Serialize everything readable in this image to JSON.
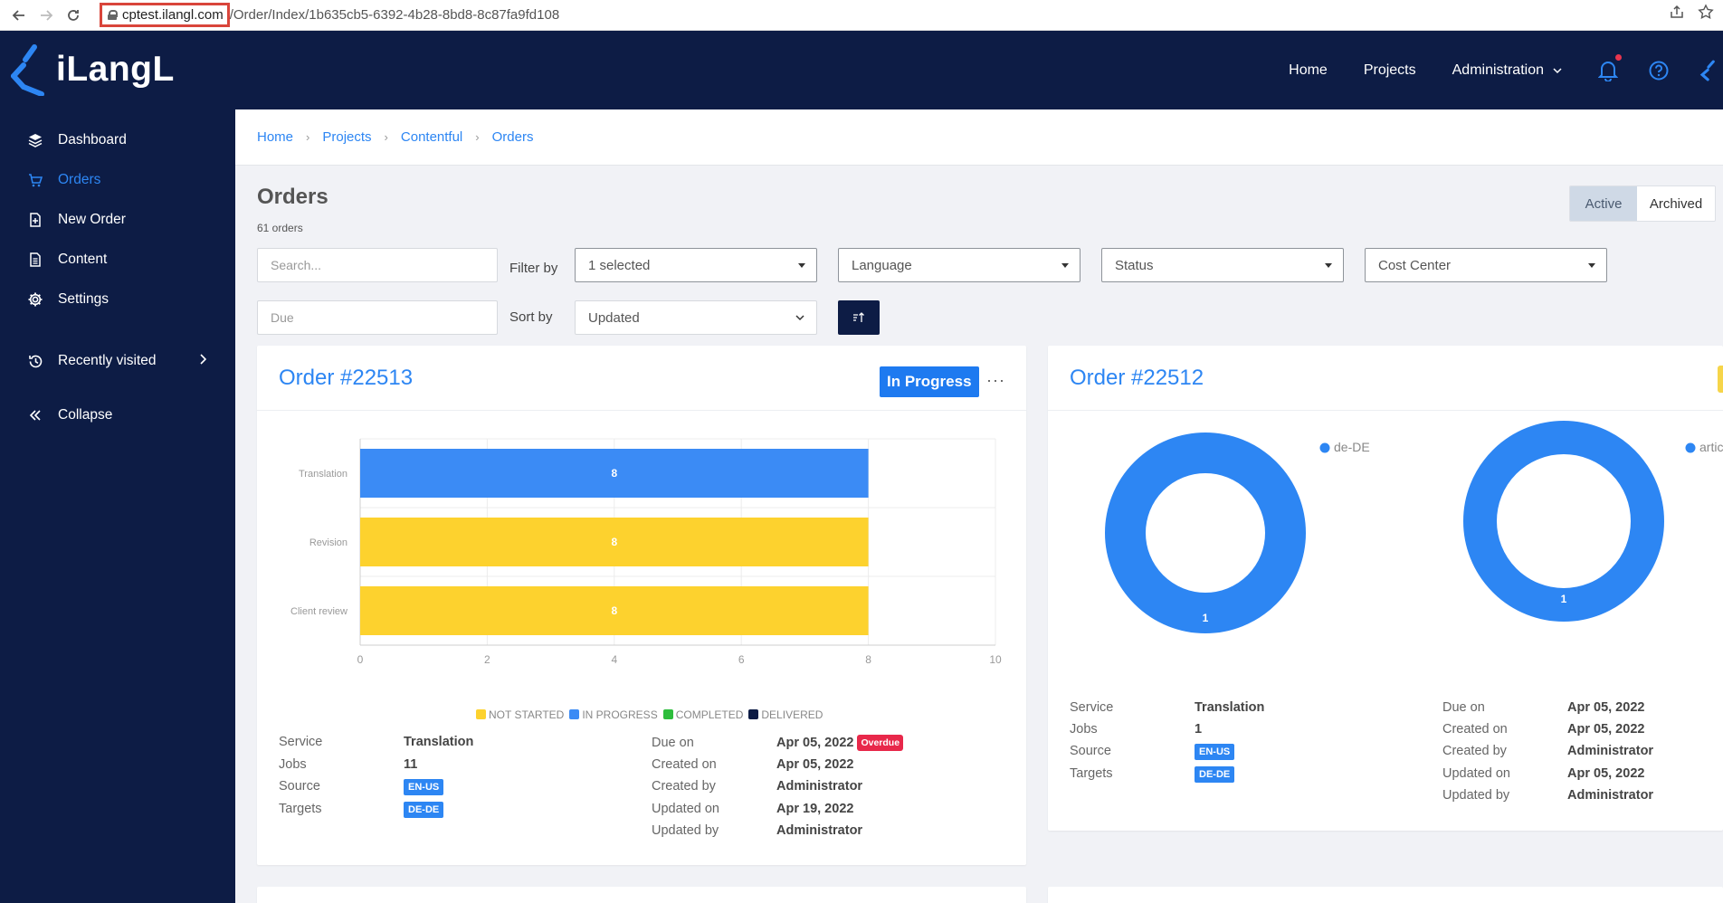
{
  "browser": {
    "url_host": "cptest.ilangl.com",
    "url_path": "/Order/Index/1b635cb5-6392-4b28-8bd8-8c87fa9fd108"
  },
  "app": {
    "logo_text": "iLangL",
    "brand_color": "#0d1c45",
    "accent_color": "#2d86f3"
  },
  "topnav": {
    "home": "Home",
    "projects": "Projects",
    "administration": "Administration"
  },
  "sidebar": {
    "items": [
      {
        "label": "Dashboard",
        "icon": "layers-icon"
      },
      {
        "label": "Orders",
        "icon": "cart-icon",
        "active": true
      },
      {
        "label": "New Order",
        "icon": "new-document-icon"
      },
      {
        "label": "Content",
        "icon": "document-icon"
      },
      {
        "label": "Settings",
        "icon": "gear-icon"
      },
      {
        "label": "Recently visited",
        "icon": "history-icon"
      },
      {
        "label": "Collapse",
        "icon": "double-chevron-left-icon"
      }
    ]
  },
  "breadcrumb": [
    "Home",
    "Projects",
    "Contentful",
    "Orders"
  ],
  "page": {
    "title": "Orders",
    "count": "61 orders"
  },
  "toggle": {
    "active": "Active",
    "archived": "Archived"
  },
  "filters": {
    "search_placeholder": "Search...",
    "filter_by_label": "Filter by",
    "project_value": "1 selected",
    "language_value": "Language",
    "status_value": "Status",
    "cost_center_value": "Cost Center",
    "due_placeholder": "Due",
    "sort_by_label": "Sort by",
    "sort_value": "Updated"
  },
  "orders": [
    {
      "title": "Order #22513",
      "status": "In Progress",
      "service_k": "Service",
      "service_v": "Translation",
      "jobs_k": "Jobs",
      "jobs_v": "11",
      "source_k": "Source",
      "source_v": "EN-US",
      "targets_k": "Targets",
      "targets_v": "DE-DE",
      "due_k": "Due on",
      "due_v": "Apr 05, 2022",
      "overdue": "Overdue",
      "created_k": "Created on",
      "created_v": "Apr 05, 2022",
      "createdby_k": "Created by",
      "createdby_v": "Administrator",
      "updated_k": "Updated on",
      "updated_v": "Apr 19, 2022",
      "updatedby_k": "Updated by",
      "updatedby_v": "Administrator"
    },
    {
      "title": "Order #22512",
      "service_k": "Service",
      "service_v": "Translation",
      "jobs_k": "Jobs",
      "jobs_v": "1",
      "source_k": "Source",
      "source_v": "EN-US",
      "targets_k": "Targets",
      "targets_v": "DE-DE",
      "due_k": "Due on",
      "due_v": "Apr 05, 2022",
      "created_k": "Created on",
      "created_v": "Apr 05, 2022",
      "createdby_k": "Created by",
      "createdby_v": "Administrator",
      "updated_k": "Updated on",
      "updated_v": "Apr 05, 2022",
      "updatedby_k": "Updated by",
      "updatedby_v": "Administrator"
    }
  ],
  "chart_data": [
    {
      "type": "bar",
      "orientation": "horizontal",
      "categories": [
        "Translation",
        "Revision",
        "Client review"
      ],
      "values": [
        8,
        8,
        8
      ],
      "bar_colors": [
        "#3b8bf5",
        "#fdd22e",
        "#fdd22e"
      ],
      "data_labels": [
        "8",
        "8",
        "8"
      ],
      "xlim": [
        0,
        10
      ],
      "xticks": [
        "0",
        "2",
        "4",
        "6",
        "8",
        "10"
      ],
      "grid": true,
      "legend_position": "bottom",
      "legend": [
        {
          "name": "NOT STARTED",
          "color": "#fdd22e"
        },
        {
          "name": "IN PROGRESS",
          "color": "#3b8bf5"
        },
        {
          "name": "COMPLETED",
          "color": "#2dbd3c"
        },
        {
          "name": "DELIVERED",
          "color": "#0d1c45"
        }
      ]
    },
    {
      "type": "pie",
      "donut": true,
      "labels": [
        "de-DE"
      ],
      "values": [
        1
      ],
      "data_labels": [
        "1"
      ],
      "color": "#2d86f3",
      "legend_position": "top-right"
    },
    {
      "type": "pie",
      "donut": true,
      "labels": [
        "articl"
      ],
      "values": [
        1
      ],
      "data_labels": [
        "1"
      ],
      "color": "#2d86f3",
      "legend_position": "top-right"
    }
  ]
}
